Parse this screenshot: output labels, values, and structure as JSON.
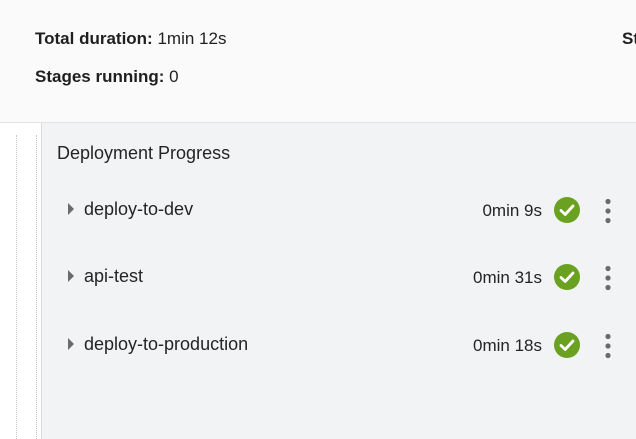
{
  "summary": {
    "total_duration_label": "Total duration:",
    "total_duration_value": "1min 12s",
    "stages_running_label": "Stages running:",
    "stages_running_value": "0",
    "right_truncated_label": "St"
  },
  "panel": {
    "title": "Deployment Progress",
    "stages": [
      {
        "name": "deploy-to-dev",
        "duration": "0min 9s",
        "status": "success",
        "status_icon": "check-circle-icon",
        "menu_icon": "more-vertical-icon",
        "expand_icon": "caret-right-icon"
      },
      {
        "name": "api-test",
        "duration": "0min 31s",
        "status": "success",
        "status_icon": "check-circle-icon",
        "menu_icon": "more-vertical-icon",
        "expand_icon": "caret-right-icon"
      },
      {
        "name": "deploy-to-production",
        "duration": "0min 18s",
        "status": "success",
        "status_icon": "check-circle-icon",
        "menu_icon": "more-vertical-icon",
        "expand_icon": "caret-right-icon"
      }
    ]
  },
  "colors": {
    "success": "#6aa121",
    "panel_background": "#f2f3f5",
    "summary_background": "#fafafa",
    "icon_gray": "#6b6b6b"
  }
}
